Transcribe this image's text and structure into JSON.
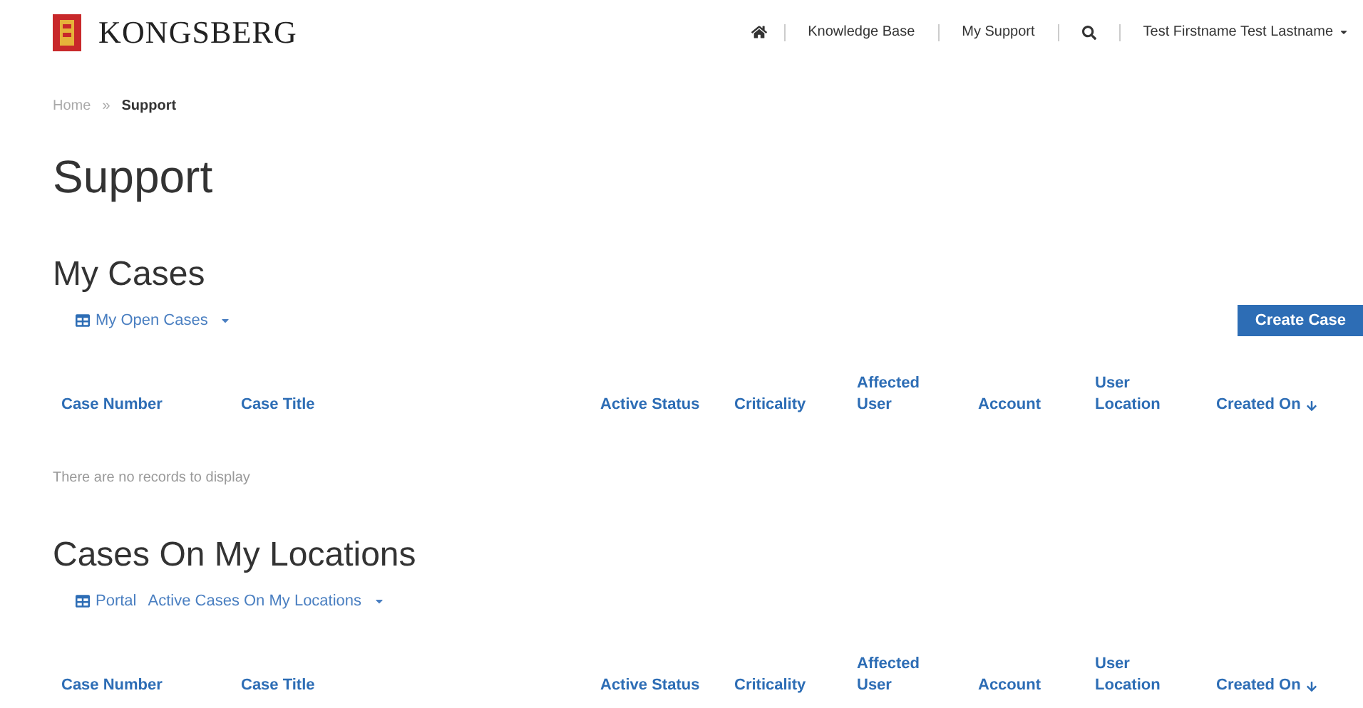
{
  "brand": {
    "name": "KONGSBERG"
  },
  "nav": {
    "items": [
      "Knowledge Base",
      "My Support"
    ],
    "user": "Test Firstname Test Lastname"
  },
  "breadcrumb": {
    "separator": "»",
    "items": [
      {
        "label": "Home",
        "current": false
      },
      {
        "label": "Support",
        "current": true
      }
    ]
  },
  "page_title": "Support",
  "sections": [
    {
      "title": "My Cases",
      "views": [
        "My Open Cases"
      ],
      "create_button": "Create Case",
      "columns": [
        {
          "label": "Case Number",
          "sorted": false
        },
        {
          "label": "Case Title",
          "sorted": false
        },
        {
          "label": "Active Status",
          "sorted": false
        },
        {
          "label": "Criticality",
          "sorted": false
        },
        {
          "label": "Affected User",
          "sorted": false
        },
        {
          "label": "Account",
          "sorted": false
        },
        {
          "label": "User Location",
          "sorted": false
        },
        {
          "label": "Created On",
          "sorted": true
        }
      ],
      "empty_message": "There are no records to display"
    },
    {
      "title": "Cases On My Locations",
      "views": [
        "Portal",
        "Active Cases On My Locations"
      ],
      "columns": [
        {
          "label": "Case Number",
          "sorted": false
        },
        {
          "label": "Case Title",
          "sorted": false
        },
        {
          "label": "Active Status",
          "sorted": false
        },
        {
          "label": "Criticality",
          "sorted": false
        },
        {
          "label": "Affected User",
          "sorted": false
        },
        {
          "label": "Account",
          "sorted": false
        },
        {
          "label": "User Location",
          "sorted": false
        },
        {
          "label": "Created On",
          "sorted": true
        }
      ]
    }
  ]
}
